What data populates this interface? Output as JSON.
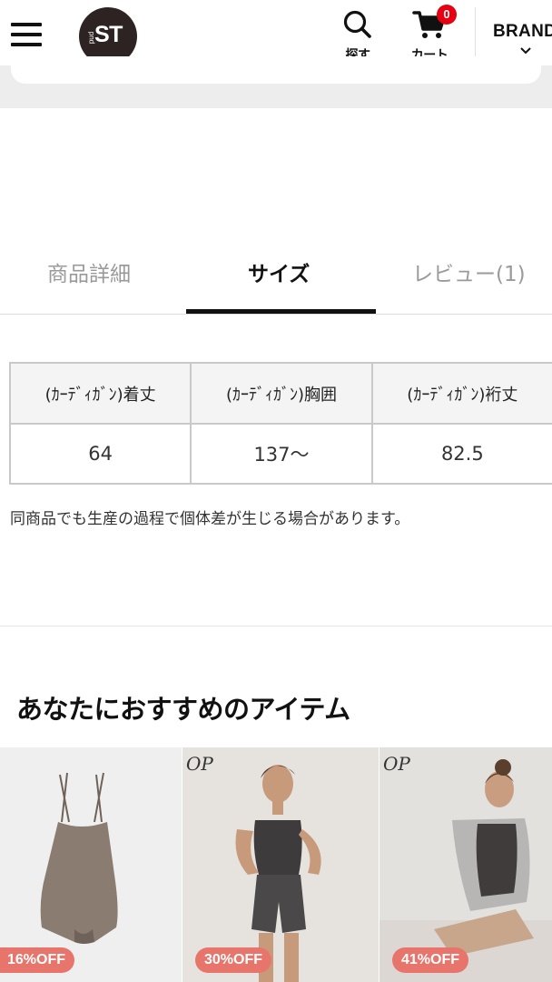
{
  "header": {
    "logo_text": "ST",
    "logo_small": "pud",
    "search_label": "探す",
    "cart_label": "カート",
    "cart_count": "0",
    "brand_label": "BRAND"
  },
  "tabs": [
    {
      "label": "商品詳細",
      "active": false
    },
    {
      "label": "サイズ",
      "active": true
    },
    {
      "label": "レビュー(1)",
      "active": false
    }
  ],
  "size_table": {
    "headers": [
      "(ｶｰﾃﾞｨｶﾞﾝ)着丈",
      "(ｶｰﾃﾞｨｶﾞﾝ)胸囲",
      "(ｶｰﾃﾞｨｶﾞﾝ)裄丈"
    ],
    "rows": [
      [
        "64",
        "137～",
        "82.5"
      ]
    ]
  },
  "size_note": "同商品でも生産の過程で個体差が生じる場合があります。",
  "recommend": {
    "title": "あなたにおすすめのアイテム",
    "items": [
      {
        "badge": "16%OFF",
        "brand_mark": ""
      },
      {
        "badge": "30%OFF",
        "brand_mark": "OP"
      },
      {
        "badge": "41%OFF",
        "brand_mark": "OP"
      }
    ]
  },
  "colors": {
    "accent": "#111111",
    "badge": "#e8756b",
    "cart_badge": "#e60012",
    "logo_bg": "#2c2322"
  }
}
